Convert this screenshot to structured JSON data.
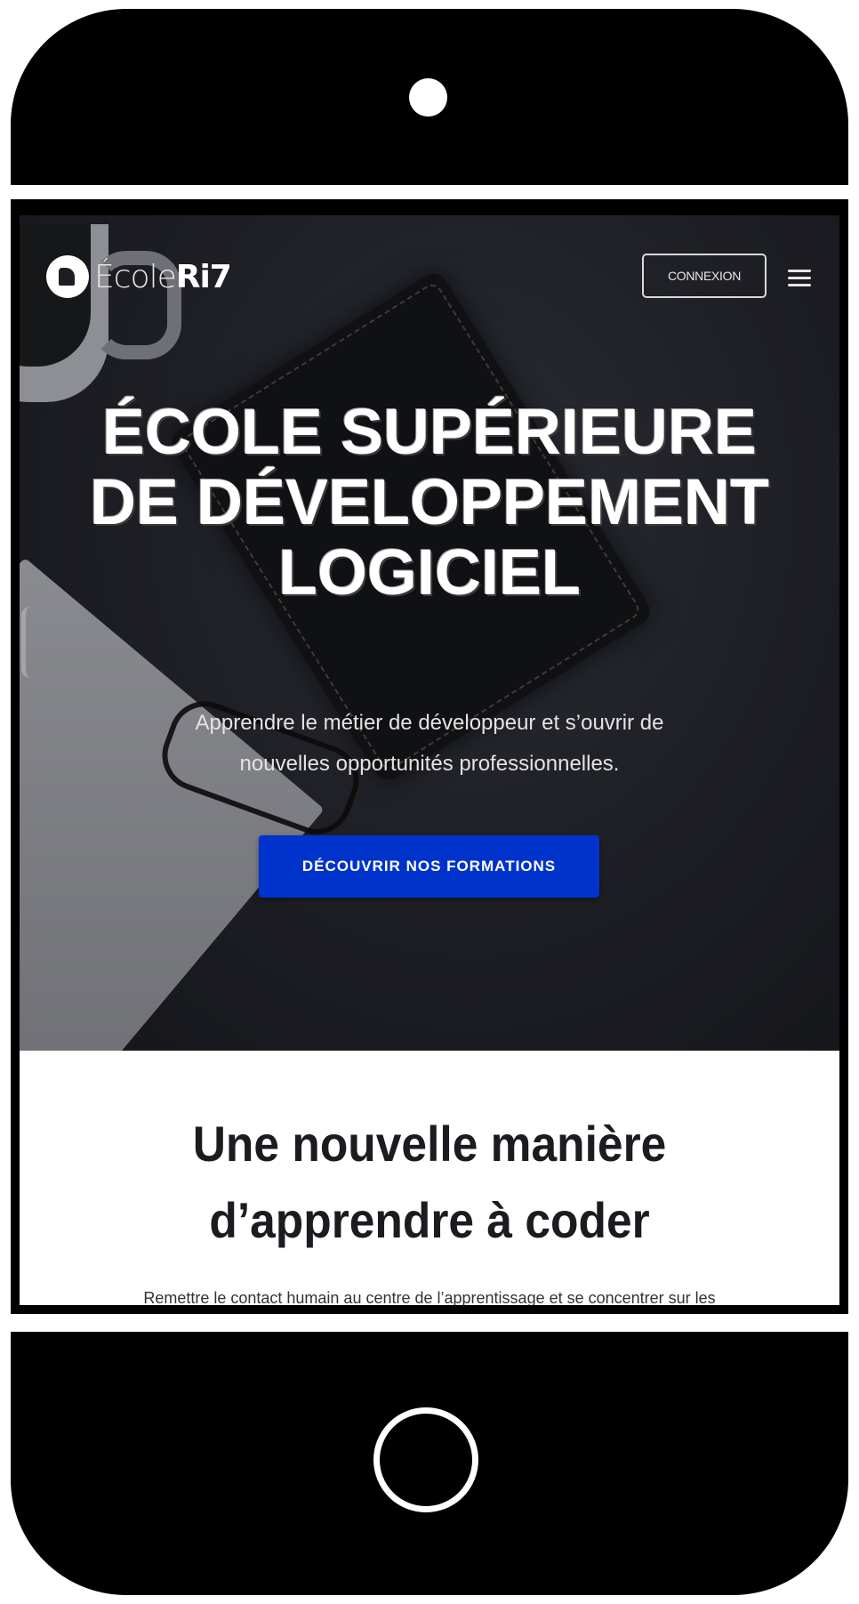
{
  "header": {
    "logo_light": "École",
    "logo_bold": "Ri7",
    "login_label": "CONNEXION"
  },
  "hero": {
    "title": "ÉCOLE SUPÉRIEURE DE DÉVELOPPEMENT LOGICIEL",
    "subtitle": "Apprendre le métier de développeur et s’ouvrir de nouvelles opportunités professionnelles.",
    "cta_label": "DÉCOUVRIR NOS FORMATIONS"
  },
  "section": {
    "title": "Une nouvelle manière d’apprendre à coder",
    "text": "Remettre le contact humain au centre de l’apprentissage et se concentrer sur les"
  },
  "colors": {
    "cta": "#0033cc",
    "hero_bg": "#1d1e24"
  },
  "icons": [
    "logo-icon",
    "menu-icon"
  ]
}
